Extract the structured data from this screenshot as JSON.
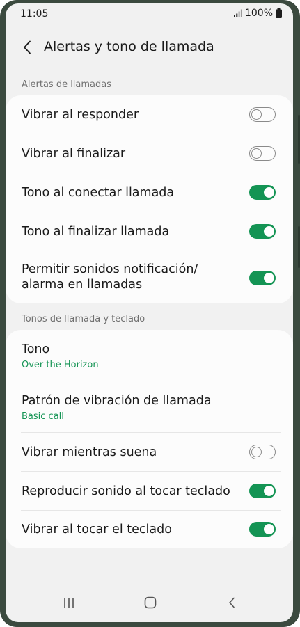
{
  "status_bar": {
    "time": "11:05",
    "battery_text": "100%",
    "icons": [
      "signal-icon",
      "battery-icon"
    ]
  },
  "header": {
    "title": "Alertas y tono de llamada",
    "back_icon": "back-arrow-icon"
  },
  "sections": [
    {
      "label": "Alertas de llamadas",
      "items": [
        {
          "title": "Vibrar al responder",
          "toggle": false
        },
        {
          "title": "Vibrar al finalizar",
          "toggle": false
        },
        {
          "title": "Tono al conectar llamada",
          "toggle": true
        },
        {
          "title": "Tono al finalizar llamada",
          "toggle": true
        },
        {
          "title": "Permitir sonidos notificación/ alarma en llamadas",
          "toggle": true
        }
      ]
    },
    {
      "label": "Tonos de llamada y teclado",
      "items": [
        {
          "title": "Tono",
          "subtitle": "Over the Horizon"
        },
        {
          "title": "Patrón de vibración de llamada",
          "subtitle": "Basic call"
        },
        {
          "title": "Vibrar mientras suena",
          "toggle": false
        },
        {
          "title": "Reproducir sonido al tocar teclado",
          "toggle": true
        },
        {
          "title": "Vibrar al tocar el teclado",
          "toggle": true
        }
      ]
    }
  ],
  "nav_bar": {
    "icons": [
      "recents-icon",
      "home-icon",
      "back-icon"
    ]
  },
  "colors": {
    "accent": "#149454",
    "background": "#f1f1f1",
    "card": "#fcfcfc",
    "frame": "#3b4a3f"
  }
}
